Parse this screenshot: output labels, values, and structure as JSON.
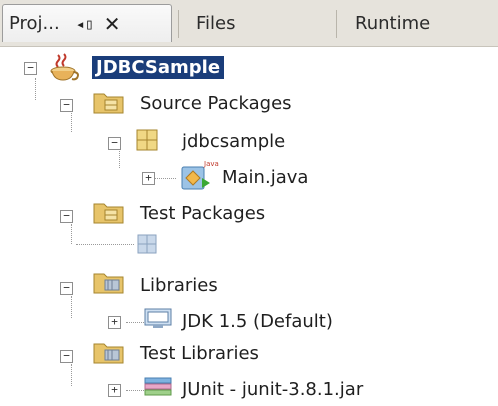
{
  "tabs": {
    "projects_label": "Proj...",
    "minimize_glyph": "◂▯",
    "close_glyph": "✕",
    "files_label": "Files",
    "runtime_label": "Runtime"
  },
  "tree": {
    "project": "JDBCSample",
    "source_packages": "Source Packages",
    "package": "jdbcsample",
    "main_file": "Main.java",
    "test_packages": "Test Packages",
    "libraries": "Libraries",
    "jdk": "JDK 1.5 (Default)",
    "test_libraries": "Test Libraries",
    "junit": "JUnit - junit-3.8.1.jar"
  },
  "toggles": {
    "expanded": "−",
    "collapsed": "+"
  },
  "colors": {
    "selection": "#1a3d7a",
    "folder": "#e7c46a",
    "tab_strip": "#e6e3dc"
  },
  "icons": {
    "project": "coffee-cup-icon",
    "folder": "package-folder-icon",
    "package": "package-icon",
    "java_file": "java-class-icon",
    "empty_package": "empty-package-icon",
    "library_folder": "library-folder-icon",
    "jdk": "jdk-library-icon",
    "jar": "jar-library-icon"
  }
}
